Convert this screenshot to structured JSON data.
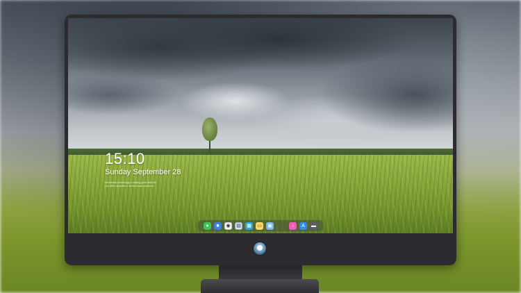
{
  "lock_screen": {
    "time": "15:10",
    "date": "Sunday September 28",
    "notice_line_1": "Information technology is making good safe this",
    "notice_line_2": "your little computer is as the house cannot do"
  },
  "dock": {
    "items": [
      {
        "name": "messages-icon",
        "glyph": "●"
      },
      {
        "name": "finder-icon",
        "glyph": "■"
      },
      {
        "name": "safari-icon",
        "glyph": "◉"
      },
      {
        "name": "preview-icon",
        "glyph": "▤"
      },
      {
        "name": "clapper-icon",
        "glyph": "▦"
      },
      {
        "name": "notes-icon",
        "glyph": "▭"
      },
      {
        "name": "photos-icon",
        "glyph": "▣"
      },
      {
        "name": "music-icon",
        "glyph": "♪"
      },
      {
        "name": "app-store-icon",
        "glyph": "A"
      },
      {
        "name": "terminal-icon",
        "glyph": "▬"
      }
    ]
  },
  "colors": {
    "monitor_bezel": "#2c2c30",
    "dock_background": "#464e3e",
    "grass": "#8caa3c",
    "sky_dark": "#3c434b"
  },
  "icons": {
    "chin_logo": "monitor-logo-icon",
    "tree": "tree-icon"
  }
}
